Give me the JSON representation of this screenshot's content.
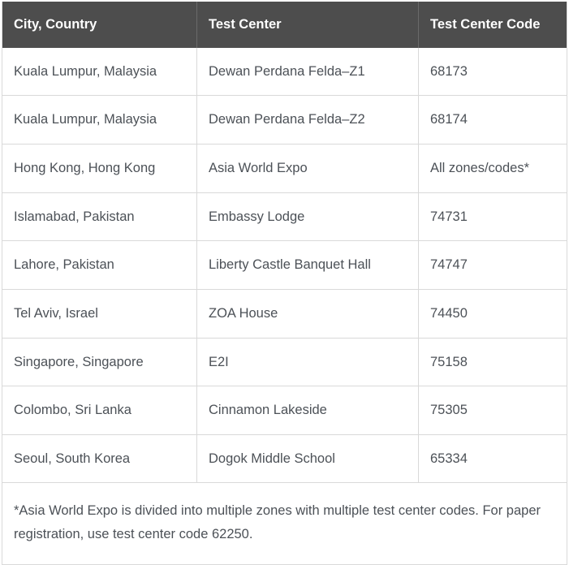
{
  "table": {
    "columns": [
      {
        "key": "city",
        "label": "City, Country"
      },
      {
        "key": "center",
        "label": "Test Center"
      },
      {
        "key": "code",
        "label": "Test Center Code"
      }
    ],
    "rows": [
      {
        "city": "Kuala Lumpur, Malaysia",
        "center": "Dewan Perdana Felda–Z1",
        "code": "68173"
      },
      {
        "city": "Kuala Lumpur, Malaysia",
        "center": "Dewan Perdana Felda–Z2",
        "code": "68174"
      },
      {
        "city": "Hong Kong, Hong Kong",
        "center": "Asia World Expo",
        "code": "All zones/codes*"
      },
      {
        "city": "Islamabad, Pakistan",
        "center": "Embassy Lodge",
        "code": "74731"
      },
      {
        "city": "Lahore, Pakistan",
        "center": "Liberty Castle Banquet Hall",
        "code": "74747"
      },
      {
        "city": "Tel Aviv, Israel",
        "center": "ZOA House",
        "code": "74450"
      },
      {
        "city": "Singapore, Singapore",
        "center": "E2I",
        "code": "75158"
      },
      {
        "city": "Colombo, Sri Lanka",
        "center": "Cinnamon Lakeside",
        "code": "75305"
      },
      {
        "city": "Seoul, South Korea",
        "center": "Dogok Middle School",
        "code": "65334"
      }
    ],
    "footnote": "*Asia World Expo is divided into multiple zones with multiple test center codes. For paper registration, use test center code 62250.",
    "colors": {
      "header_background": "#4d4d4d",
      "header_text": "#ffffff",
      "cell_text": "#4c5157",
      "border": "#d9d9d9",
      "cell_background": "#ffffff"
    }
  }
}
